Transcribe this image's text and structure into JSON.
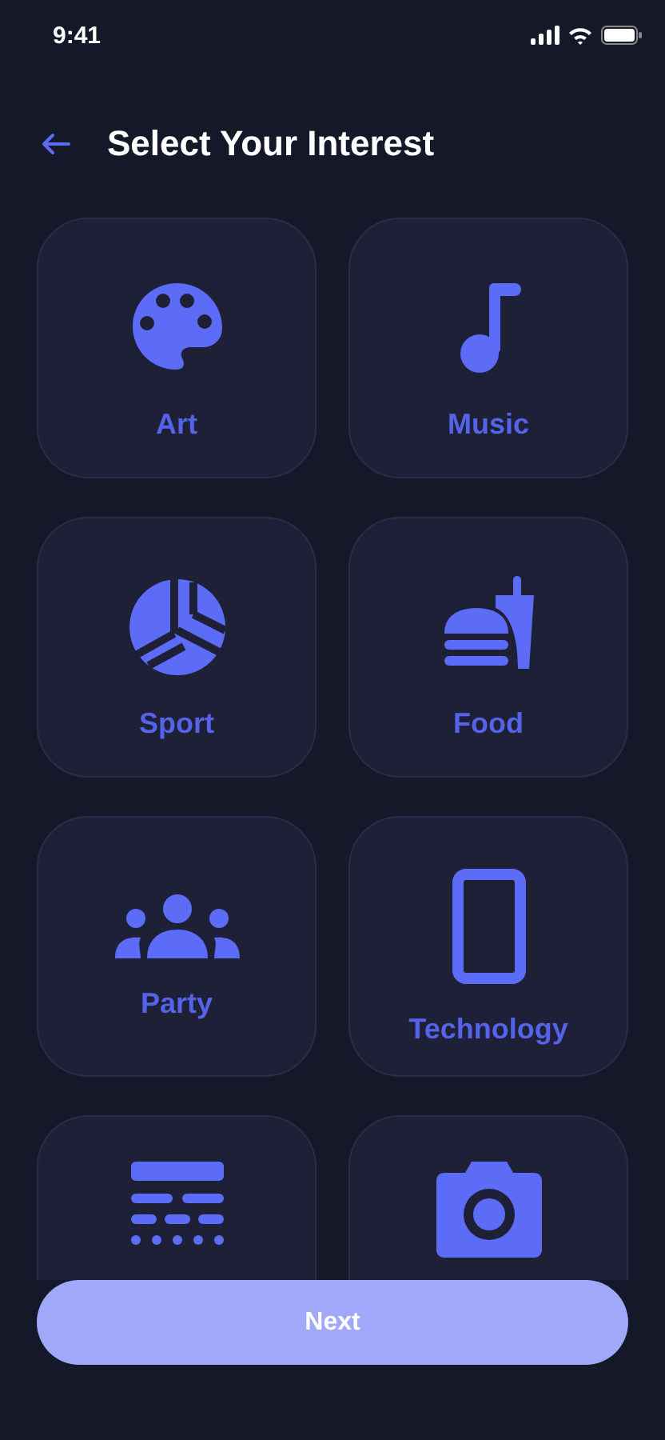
{
  "status_bar": {
    "time": "9:41"
  },
  "header": {
    "title": "Select Your Interest"
  },
  "interests": [
    {
      "kind": "palette",
      "label": "Art",
      "selected": false
    },
    {
      "kind": "note",
      "label": "Music",
      "selected": false
    },
    {
      "kind": "ball",
      "label": "Sport",
      "selected": false
    },
    {
      "kind": "burger",
      "label": "Food",
      "selected": false
    },
    {
      "kind": "people",
      "label": "Party",
      "selected": false
    },
    {
      "kind": "phone",
      "label": "Technology",
      "selected": false
    },
    {
      "kind": "lines",
      "selected": false
    },
    {
      "kind": "camera",
      "selected": false
    }
  ],
  "next_button": {
    "label": "Next"
  }
}
